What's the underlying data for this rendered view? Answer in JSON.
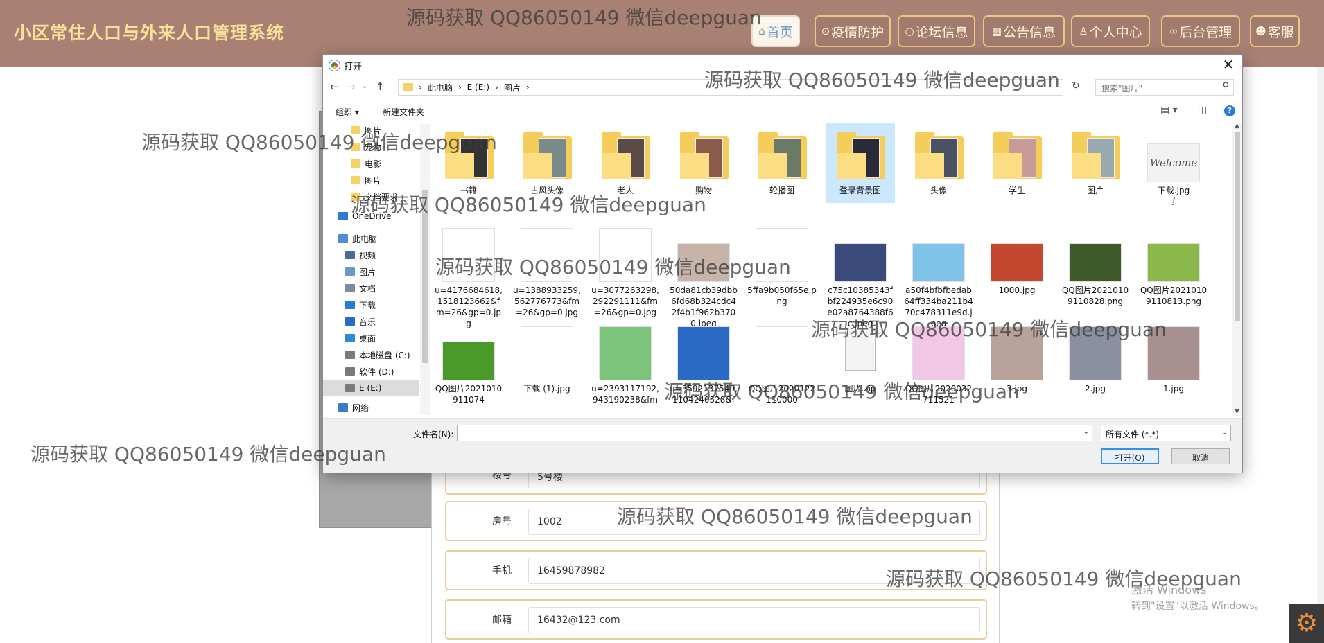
{
  "header": {
    "site_title": "小区常住人口与外来人口管理系统",
    "nav": [
      {
        "label": "首页",
        "icon": "home-icon",
        "glyph": "⌂",
        "active": true
      },
      {
        "label": "疫情防护",
        "icon": "shield-icon",
        "glyph": "⊙"
      },
      {
        "label": "论坛信息",
        "icon": "chat-icon",
        "glyph": "○"
      },
      {
        "label": "公告信息",
        "icon": "notice-icon",
        "glyph": "▦"
      },
      {
        "label": "个人中心",
        "icon": "user-icon",
        "glyph": "♙"
      },
      {
        "label": "后台管理",
        "icon": "link-icon",
        "glyph": "∞"
      },
      {
        "label": "客服",
        "icon": "customer-service-icon",
        "glyph": "☻"
      }
    ]
  },
  "form": {
    "rows": [
      {
        "label": "楼号",
        "value": "5号楼"
      },
      {
        "label": "房号",
        "value": "1002"
      },
      {
        "label": "手机",
        "value": "16459878982"
      },
      {
        "label": "邮箱",
        "value": "16432@123.com"
      }
    ]
  },
  "dialog": {
    "title": "打开",
    "breadcrumb": [
      "此电脑",
      "E (E:)",
      "图片"
    ],
    "search_placeholder": "搜索\"图片\"",
    "toolbar": {
      "organize": "组织 ▾",
      "new_folder": "新建文件夹"
    },
    "sidebar": [
      {
        "label": "图片",
        "icon": "folder-icon"
      },
      {
        "label": "宠物",
        "icon": "folder-icon"
      },
      {
        "label": "电影",
        "icon": "folder-icon"
      },
      {
        "label": "图片",
        "icon": "folder-icon"
      },
      {
        "label": "文档要求",
        "icon": "folder-icon"
      },
      {
        "label": "OneDrive",
        "icon": "onedrive-icon"
      },
      {
        "label": "此电脑",
        "icon": "computer-icon"
      },
      {
        "label": "视频",
        "icon": "video-icon"
      },
      {
        "label": "图片",
        "icon": "pictures-icon"
      },
      {
        "label": "文档",
        "icon": "documents-icon"
      },
      {
        "label": "下载",
        "icon": "download-icon"
      },
      {
        "label": "音乐",
        "icon": "music-icon"
      },
      {
        "label": "桌面",
        "icon": "desktop-icon"
      },
      {
        "label": "本地磁盘 (C:)",
        "icon": "drive-icon"
      },
      {
        "label": "软件 (D:)",
        "icon": "drive-icon"
      },
      {
        "label": "E (E:)",
        "icon": "drive-icon",
        "selected": true
      },
      {
        "label": "网络",
        "icon": "network-icon"
      }
    ],
    "files": [
      {
        "name": "书籍",
        "kind": "folder",
        "color": "#333333"
      },
      {
        "name": "古风头像",
        "kind": "folder",
        "color": "#7a8a8a"
      },
      {
        "name": "老人",
        "kind": "folder",
        "color": "#5a4a48"
      },
      {
        "name": "购物",
        "kind": "folder",
        "color": "#8a5a4a"
      },
      {
        "name": "轮播图",
        "kind": "folder",
        "color": "#6a7a66"
      },
      {
        "name": "登录背景图",
        "kind": "folder",
        "color": "#2a2a38",
        "selected": true
      },
      {
        "name": "头像",
        "kind": "folder",
        "color": "#4a5060"
      },
      {
        "name": "学生",
        "kind": "folder",
        "color": "#c89a9a"
      },
      {
        "name": "图片",
        "kind": "folder",
        "color": "#9aa8b0"
      },
      {
        "name": "下载.jpg",
        "kind": "image",
        "color": "#f2f2f2",
        "text": "Welcome !"
      },
      {
        "name": "u=4176684618,1518123662&fm=26&gp=0.jpg",
        "kind": "image",
        "color": "#ffffff"
      },
      {
        "name": "u=1388933259,562776773&fm=26&gp=0.jpg",
        "kind": "image",
        "color": "#ffffff"
      },
      {
        "name": "u=3077263298,292291111&fm=26&gp=0.jpg",
        "kind": "image",
        "color": "#ffffff"
      },
      {
        "name": "50da81cb39dbb6fd68b324cdc42f4b1f962b3700.jpeg",
        "kind": "image",
        "color": "#c6b4a8"
      },
      {
        "name": "5ffa9b050f65e.png",
        "kind": "image",
        "color": "#ffffff"
      },
      {
        "name": "c75c10385343fbf224935e6c90e02a8764388f6c.jpeg",
        "kind": "image",
        "color": "#3a4a7a"
      },
      {
        "name": "a50f4bfbfbedab64ff334ba211b470c478311e9d.jpeg",
        "kind": "image",
        "color": "#7fc4e8"
      },
      {
        "name": "1000.jpg",
        "kind": "image",
        "color": "#c4482f"
      },
      {
        "name": "QQ图片20210109110828.png",
        "kind": "image",
        "color": "#3c5a2a"
      },
      {
        "name": "QQ图片20210109110813.png",
        "kind": "image",
        "color": "#8ab84a"
      },
      {
        "name": "QQ图片2021010911074",
        "kind": "image",
        "color": "#4a9a2a"
      },
      {
        "name": "下载 (1).jpg",
        "kind": "image",
        "color": "#ffffff"
      },
      {
        "name": "u=2393117192,943190238&fm",
        "kind": "image",
        "color": "#7cc47c"
      },
      {
        "name": "u=3592137549,1104240528&f",
        "kind": "image",
        "color": "#2a6ac4"
      },
      {
        "name": "QQ图片2020122110000",
        "kind": "image",
        "color": "#ffffff"
      },
      {
        "name": "图片.zip",
        "kind": "zip",
        "color": "#f4f4f4"
      },
      {
        "name": "QQ图片2020032711521",
        "kind": "image",
        "color": "#f0c8e6"
      },
      {
        "name": "3.jpg",
        "kind": "image",
        "color": "#b8a29a"
      },
      {
        "name": "2.jpg",
        "kind": "image",
        "color": "#8a90a0"
      },
      {
        "name": "1.jpg",
        "kind": "image",
        "color": "#a89090"
      }
    ],
    "filename_label": "文件名(N):",
    "filename_value": "",
    "filter": "所有文件 (*.*)",
    "open_button": "打开(O)",
    "cancel_button": "取消"
  },
  "watermark_text": "源码获取 QQ86050149 微信deepguan",
  "windows_activation": {
    "title": "激活 Windows",
    "subtitle": "转到\"设置\"以激活 Windows。"
  }
}
